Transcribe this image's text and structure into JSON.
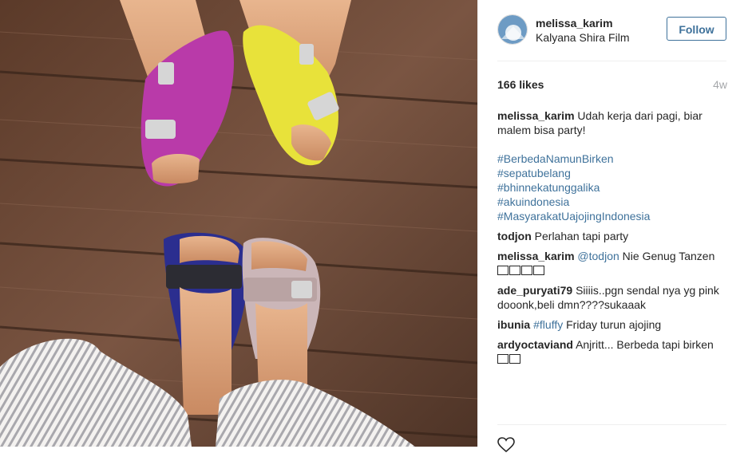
{
  "post": {
    "username": "melissa_karim",
    "location": "Kalyana Shira Film",
    "follow_label": "Follow",
    "likes": "166 likes",
    "time": "4w"
  },
  "caption": {
    "user": "melissa_karim",
    "text": "Udah kerja dari pagi, biar malem bisa party!",
    "tags": [
      "#BerbedaNamunBirken",
      "#sepatubelang",
      "#bhinnekatunggalika",
      "#akuindonesia",
      "#MasyarakatUajojingIndonesia"
    ]
  },
  "comments": [
    {
      "user": "todjon",
      "text": "Perlahan tapi party"
    },
    {
      "user": "melissa_karim",
      "mention": "@todjon",
      "text": "Nie Genug Tanzen",
      "emoji_count": 4
    },
    {
      "user": "ade_puryati79",
      "text": "Siiiis..pgn sendal nya yg pink dooonk,beli dmn????sukaaak"
    },
    {
      "user": "ibunia",
      "mention": "#fluffy",
      "text": "Friday turun ajojing"
    },
    {
      "user": "ardyoctaviand",
      "text": "Anjritt... Berbeda tapi birken",
      "emoji_count": 2
    }
  ],
  "icons": {
    "heart": "heart-outline-icon",
    "avatar": "avatar-image"
  },
  "colors": {
    "link": "#3f729b",
    "text": "#262626",
    "muted": "#a5a7aa",
    "border": "#efefef"
  }
}
